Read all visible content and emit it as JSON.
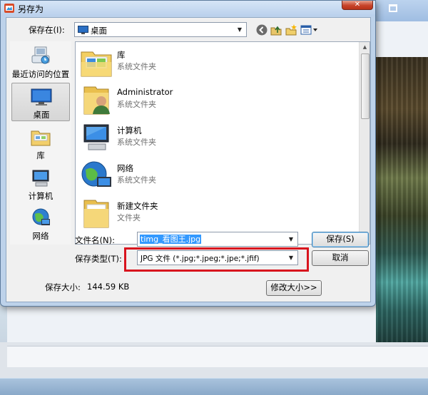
{
  "dialog": {
    "title": "另存为",
    "close_label": "✕"
  },
  "toolbar": {
    "save_in_label": "保存在(I):",
    "location": "桌面"
  },
  "places": [
    {
      "label": "最近访问的位置",
      "icon": "recent-places-icon"
    },
    {
      "label": "桌面",
      "icon": "desktop-icon",
      "selected": true
    },
    {
      "label": "库",
      "icon": "libraries-icon"
    },
    {
      "label": "计算机",
      "icon": "computer-icon"
    },
    {
      "label": "网络",
      "icon": "network-icon"
    }
  ],
  "files": [
    {
      "name": "库",
      "type": "系统文件夹",
      "icon": "libraries-folder-icon"
    },
    {
      "name": "Administrator",
      "type": "系统文件夹",
      "icon": "user-folder-icon"
    },
    {
      "name": "计算机",
      "type": "系统文件夹",
      "icon": "computer-icon"
    },
    {
      "name": "网络",
      "type": "系统文件夹",
      "icon": "network-icon"
    },
    {
      "name": "新建文件夹",
      "type": "文件夹",
      "icon": "folder-icon"
    }
  ],
  "form": {
    "filename_label": "文件名(N):",
    "filename_value": "timg_看图王.jpg",
    "filetype_label": "保存类型(T):",
    "filetype_value": "JPG 文件 (*.jpg;*.jpeg;*.jpe;*.jfif)",
    "save_button": "保存(S)",
    "cancel_button": "取消",
    "size_label": "保存大小:",
    "size_value": "144.59 KB",
    "resize_button": "修改大小>>"
  },
  "colors": {
    "highlight_box": "#d8141e",
    "selection": "#3399ff"
  }
}
